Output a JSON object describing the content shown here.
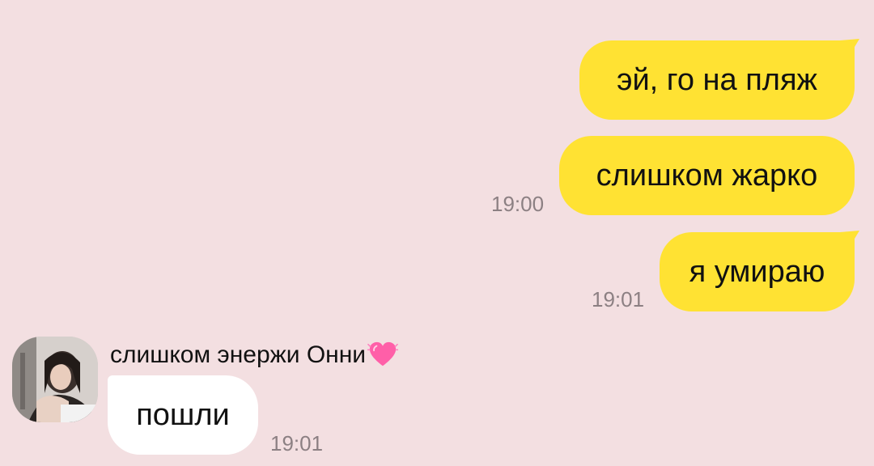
{
  "messages": [
    {
      "direction": "outgoing",
      "text": "эй, го на пляж",
      "time": ""
    },
    {
      "direction": "outgoing",
      "text": "слишком жарко",
      "time": "19:00"
    },
    {
      "direction": "outgoing",
      "text": "я умираю",
      "time": "19:01"
    },
    {
      "direction": "incoming",
      "sender": "слишком энержи Онни",
      "sender_emoji": "heart-icon",
      "text": "пошли",
      "time": "19:01"
    }
  ],
  "colors": {
    "background": "#f3dfe1",
    "outgoing_bubble": "#ffe233",
    "incoming_bubble": "#ffffff",
    "timestamp": "#8c8083"
  }
}
